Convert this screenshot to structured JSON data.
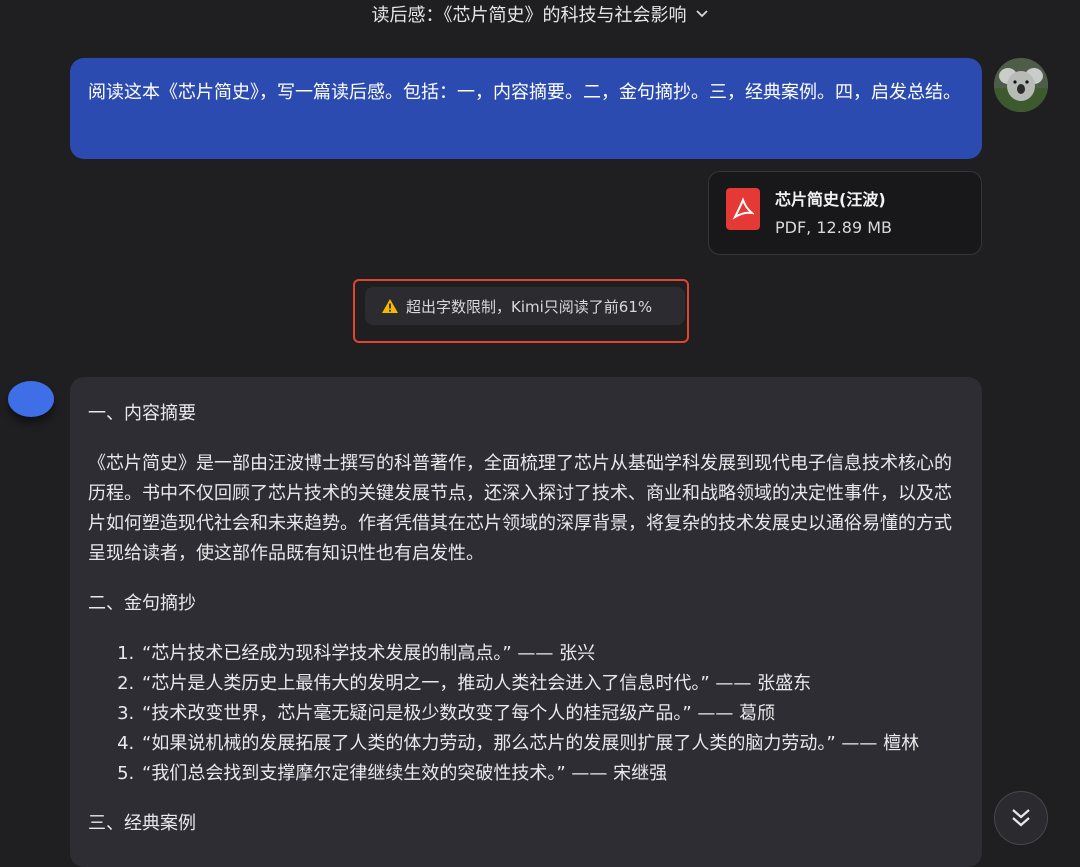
{
  "header": {
    "title": "读后感：《芯片简史》的科技与社会影响"
  },
  "user_message": {
    "text": "阅读这本《芯片简史》，写一篇读后感。包括：一，内容摘要。二，金句摘抄。三，经典案例。四，启发总结。"
  },
  "attachment": {
    "name": "芯片简史(汪波)",
    "meta": "PDF, 12.89 MB"
  },
  "notice": {
    "text": "超出字数限制，Kimi只阅读了前61%"
  },
  "assistant_message": {
    "section1_title": "一、内容摘要",
    "summary": "《芯片简史》是一部由汪波博士撰写的科普著作，全面梳理了芯片从基础学科发展到现代电子信息技术核心的历程。书中不仅回顾了芯片技术的关键发展节点，还深入探讨了技术、商业和战略领域的决定性事件，以及芯片如何塑造现代社会和未来趋势。作者凭借其在芯片领域的深厚背景，将复杂的技术发展史以通俗易懂的方式呈现给读者，使这部作品既有知识性也有启发性。",
    "section2_title": "二、金句摘抄",
    "quotes": [
      "“芯片技术已经成为现科学技术发展的制高点。” —— 张兴",
      "“芯片是人类历史上最伟大的发明之一，推动人类社会进入了信息时代。” —— 张盛东",
      "“技术改变世界，芯片毫无疑问是极少数改变了每个人的桂冠级产品。” —— 葛颀",
      "“如果说机械的发展拓展了人类的体力劳动，那么芯片的发展则扩展了人类的脑力劳动。” —— 檀林",
      "“我们总会找到支撑摩尔定律继续生效的突破性技术。” —— 宋继强"
    ],
    "section3_title": "三、经典案例"
  },
  "icons": {
    "title_chevron": "chevron-down-icon",
    "warning": "warning-icon",
    "pdf": "pdf-icon",
    "scroll_down": "double-chevron-down-icon"
  },
  "colors": {
    "background": "#1f1f22",
    "user_bubble": "#2b4bb0",
    "bot_bubble": "#2d2d33",
    "warning": "#f5b800",
    "highlight_frame": "#e0452f",
    "pdf_red": "#e53935"
  }
}
